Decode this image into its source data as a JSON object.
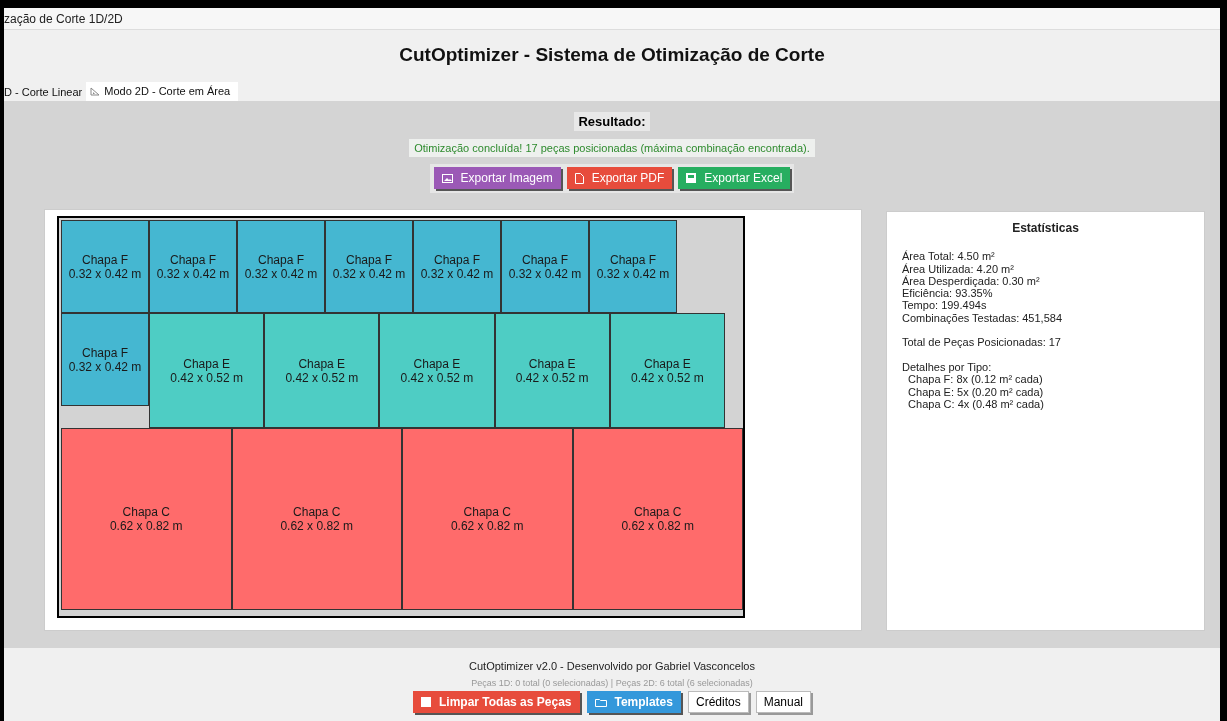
{
  "window": {
    "title": "zação de Corte 1D/2D"
  },
  "header": {
    "title": "CutOptimizer - Sistema de Otimização de Corte"
  },
  "tabs": [
    {
      "label": "D - Corte Linear",
      "selected": false
    },
    {
      "label": "Modo 2D - Corte em Área",
      "selected": true
    }
  ],
  "result": {
    "heading": "Resultado:",
    "message": "Otimização concluída! 17 peças posicionadas (máxima combinação encontrada).",
    "buttons": [
      {
        "label": "Exportar Imagem",
        "color": "#9b59b6"
      },
      {
        "label": "Exportar PDF",
        "color": "#e74c3c"
      },
      {
        "label": "Exportar Excel",
        "color": "#27ae60"
      }
    ]
  },
  "layout": {
    "pieces": [
      {
        "name": "Chapa F",
        "size": "0.32 x 0.42 m",
        "kind": "small",
        "color": "#45b7d1"
      },
      {
        "name": "Chapa F",
        "size": "0.32 x 0.42 m",
        "kind": "small",
        "color": "#45b7d1"
      },
      {
        "name": "Chapa F",
        "size": "0.32 x 0.42 m",
        "kind": "small",
        "color": "#45b7d1"
      },
      {
        "name": "Chapa F",
        "size": "0.32 x 0.42 m",
        "kind": "small",
        "color": "#45b7d1"
      },
      {
        "name": "Chapa F",
        "size": "0.32 x 0.42 m",
        "kind": "small",
        "color": "#45b7d1"
      },
      {
        "name": "Chapa F",
        "size": "0.32 x 0.42 m",
        "kind": "small",
        "color": "#45b7d1"
      },
      {
        "name": "Chapa F",
        "size": "0.32 x 0.42 m",
        "kind": "small",
        "color": "#45b7d1"
      },
      {
        "name": "Chapa F",
        "size": "0.32 x 0.42 m",
        "kind": "small",
        "color": "#45b7d1"
      },
      {
        "name": "Chapa E",
        "size": "0.42 x 0.52 m",
        "kind": "medium",
        "color": "#4ecdc4"
      },
      {
        "name": "Chapa E",
        "size": "0.42 x 0.52 m",
        "kind": "medium",
        "color": "#4ecdc4"
      },
      {
        "name": "Chapa E",
        "size": "0.42 x 0.52 m",
        "kind": "medium",
        "color": "#4ecdc4"
      },
      {
        "name": "Chapa E",
        "size": "0.42 x 0.52 m",
        "kind": "medium",
        "color": "#4ecdc4"
      },
      {
        "name": "Chapa E",
        "size": "0.42 x 0.52 m",
        "kind": "medium",
        "color": "#4ecdc4"
      },
      {
        "name": "Chapa C",
        "size": "0.62 x 0.82 m",
        "kind": "large",
        "color": "#ff6b6b"
      },
      {
        "name": "Chapa C",
        "size": "0.62 x 0.82 m",
        "kind": "large",
        "color": "#ff6b6b"
      },
      {
        "name": "Chapa C",
        "size": "0.62 x 0.82 m",
        "kind": "large",
        "color": "#ff6b6b"
      },
      {
        "name": "Chapa C",
        "size": "0.62 x 0.82 m",
        "kind": "large",
        "color": "#ff6b6b"
      }
    ]
  },
  "statistics": {
    "title": "Estatísticas",
    "groups": [
      [
        "Área Total: 4.50 m²",
        "Área Utilizada: 4.20 m²",
        "Área Desperdiçada: 0.30 m²",
        "Eficiência: 93.35%",
        "Tempo: 199.494s",
        "Combinações Testadas: 451,584"
      ],
      [
        "Total de Peças Posicionadas: 17"
      ],
      [
        "Detalhes por Tipo:",
        "  Chapa F: 8x (0.12 m² cada)",
        "  Chapa E: 5x (0.20 m² cada)",
        "  Chapa C: 4x (0.48 m² cada)"
      ]
    ]
  },
  "footer": {
    "credit": "CutOptimizer v2.0 - Desenvolvido por Gabriel Vasconcelos",
    "counts": "Peças 1D: 0 total (0 selecionadas) | Peças 2D: 6 total (6 selecionadas)",
    "buttons": [
      {
        "label": "Limpar Todas as Peças",
        "kind": "danger"
      },
      {
        "label": "Templates",
        "kind": "primary"
      },
      {
        "label": "Créditos",
        "kind": "plain"
      },
      {
        "label": "Manual",
        "kind": "plain"
      }
    ]
  }
}
